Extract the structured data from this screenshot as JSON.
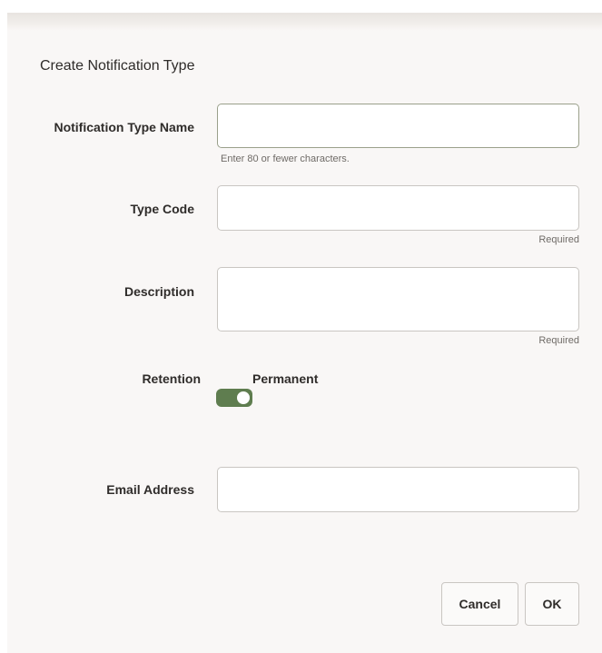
{
  "dialog": {
    "title": "Create Notification Type"
  },
  "form": {
    "notification_type_name": {
      "label": "Notification Type Name",
      "value": "",
      "helper": "Enter 80 or fewer characters."
    },
    "type_code": {
      "label": "Type Code",
      "value": "",
      "required_text": "Required"
    },
    "description": {
      "label": "Description",
      "value": "",
      "required_text": "Required"
    },
    "retention": {
      "label": "Retention",
      "switch_label": "Permanent",
      "enabled": true
    },
    "email_address": {
      "label": "Email Address",
      "value": ""
    }
  },
  "buttons": {
    "cancel_label": "Cancel",
    "ok_label": "OK"
  },
  "colors": {
    "toggle_on": "#5f7d4f",
    "background": "#f9f7f6"
  }
}
